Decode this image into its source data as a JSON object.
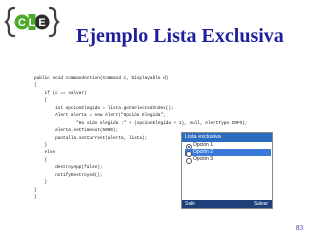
{
  "logo": {
    "letters": [
      "C",
      "L",
      "E"
    ],
    "colors": {
      "green": "#4caa2b",
      "dark": "#2b2b2b",
      "brace": "#3f3f3f"
    }
  },
  "slide": {
    "title": "Ejemplo Lista Exclusiva",
    "page_number": "83",
    "title_color": "#1f1f9e"
  },
  "code_lines": [
    "public void commandAction(Command c, Displayable d)",
    "{",
    "    if (c == salvar)",
    "    {",
    "        int opcionElegida = lista.getSelectedIndex();",
    "        Alert alerta = new Alert(\"Opción Elegida\",",
    "                \"Ha sido elegida :\" + (opcionElegida + 1), null, AlertType.INFO);",
    "        alerta.setTimeout(5000);",
    "        pantalla.setCurrent(alerta, lista);",
    "    }",
    "    else",
    "    {",
    "        destroyApp(false);",
    "        notifyDestroyed();",
    "    }",
    "}",
    "}"
  ],
  "phone": {
    "title": "Lista exclusiva",
    "options": [
      {
        "label": "Opción 1",
        "checked": true,
        "highlighted": false
      },
      {
        "label": "Opción 2",
        "checked": false,
        "highlighted": true
      },
      {
        "label": "Opción 3",
        "checked": false,
        "highlighted": false
      }
    ],
    "soft_left": "Salir",
    "soft_right": "Salvar",
    "colors": {
      "title_bar": "#2b6cbf",
      "highlight": "#3b7ad8",
      "soft_bar": "#1e3f7a"
    }
  }
}
